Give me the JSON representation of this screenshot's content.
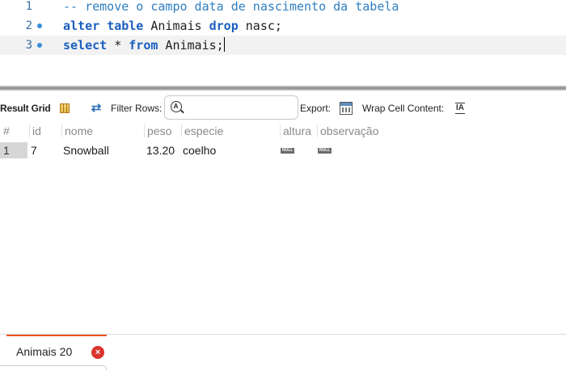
{
  "editor": {
    "lines": [
      {
        "num": "1",
        "comment": "-- remove o campo data de nascimento da tabela"
      },
      {
        "num": "2",
        "kw1": "alter",
        "kw2": "table",
        "text1": " Animais ",
        "kw3": "drop",
        "text2": " nasc;"
      },
      {
        "num": "3",
        "kw1": "select",
        "text1": " * ",
        "kw2": "from",
        "text2": " Animais;"
      }
    ]
  },
  "toolbar": {
    "result_grid": "Result Grid",
    "filter_rows": "Filter Rows:",
    "search_placeholder": "",
    "export": "Export:",
    "wrap_cell": "Wrap Cell Content:",
    "wrap_icon_glyph": "IA"
  },
  "grid": {
    "columns": [
      "#",
      "id",
      "nome",
      "peso",
      "especie",
      "altura",
      "observação"
    ],
    "rows": [
      {
        "rownum": "1",
        "id": "7",
        "nome": "Snowball",
        "peso": "13.20",
        "especie": "coelho",
        "altura": "NULL",
        "observacao": "NULL"
      }
    ]
  },
  "tabs": [
    {
      "label": "Animais 20",
      "close": "×"
    }
  ],
  "colors": {
    "keyword": "#1b5fbf",
    "comment": "#2f7fc1",
    "tab_accent": "#e9541e",
    "close_red": "#d9342b"
  }
}
